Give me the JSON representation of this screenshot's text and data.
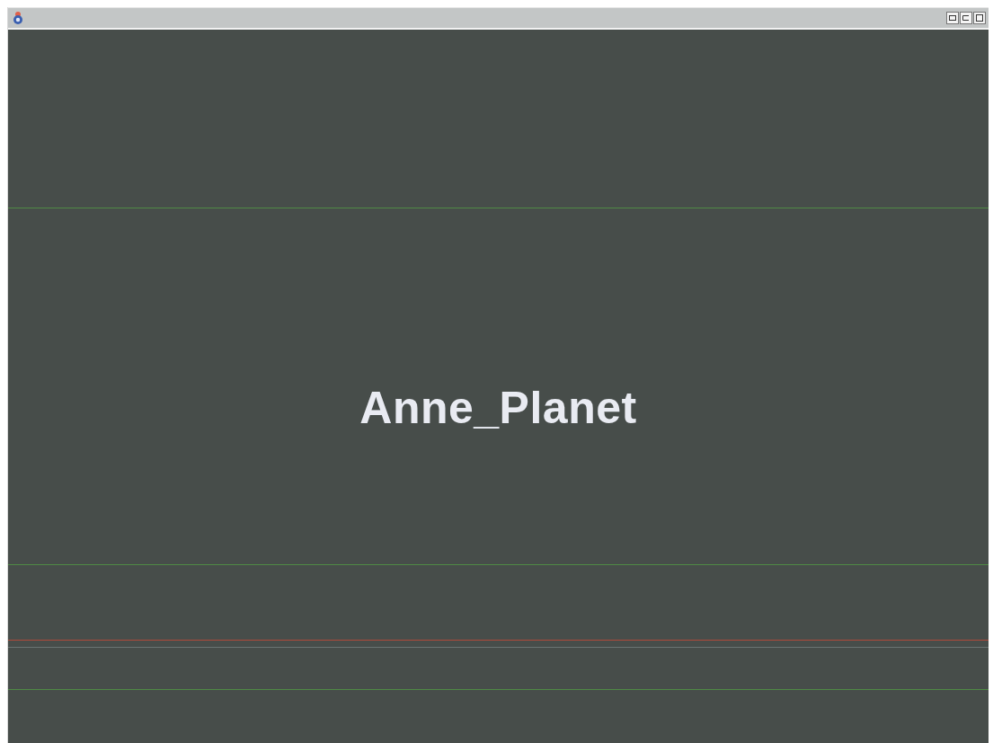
{
  "canvas": {
    "title": "Anne_Planet"
  }
}
